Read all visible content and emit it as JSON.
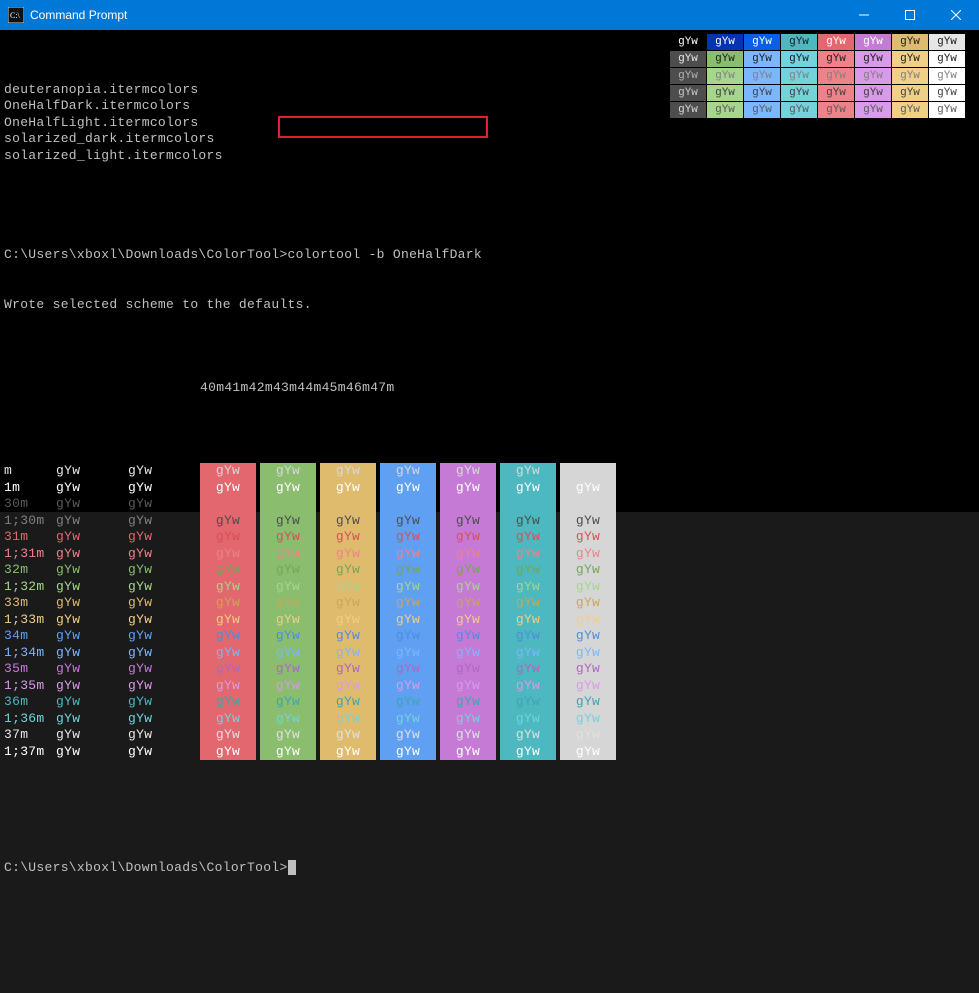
{
  "window": {
    "title": "Command Prompt"
  },
  "listing": [
    "deuteranopia.itermcolors",
    "OneHalfDark.itermcolors",
    "OneHalfLight.itermcolors",
    "solarized_dark.itermcolors",
    "solarized_light.itermcolors"
  ],
  "prompt_path": "C:\\Users\\xboxl\\Downloads\\ColorTool>",
  "command": "colortool -b OneHalfDark",
  "output_msg": "Wrote selected scheme to the defaults.",
  "bg_headers": [
    "40m",
    "41m",
    "42m",
    "43m",
    "44m",
    "45m",
    "46m",
    "47m"
  ],
  "samp": "gYw",
  "row_labels": [
    "m",
    "1m",
    "30m",
    "1;30m",
    "31m",
    "1;31m",
    "32m",
    "1;32m",
    "33m",
    "1;33m",
    "34m",
    "1;34m",
    "35m",
    "1;35m",
    "36m",
    "1;36m",
    "37m",
    "1;37m"
  ],
  "fg_classes_a": [
    "fg-white",
    "fg-bwhite",
    "fg-dgray",
    "fg-gray",
    "fg-red",
    "fg-bred",
    "fg-green",
    "fg-bgreen",
    "fg-yellow",
    "fg-byellow",
    "fg-blue",
    "fg-bblue",
    "fg-mag",
    "fg-bmag",
    "fg-cyan",
    "fg-bcyan",
    "fg-white",
    "fg-bwhite"
  ],
  "on_bg_fg": {
    "m": "#d8d8d8",
    "1m": "#fff",
    "30m": "#1c1c1c",
    "1;30m": "#4d4d4d",
    "31m": "#d65055",
    "1;31m": "#ef8289",
    "32m": "#74a657",
    "1;32m": "#a5d68c",
    "33m": "#caa657",
    "1;33m": "#f0cf87",
    "34m": "#4c8de0",
    "1;34m": "#7cb6ff",
    "35m": "#b066c2",
    "1;35m": "#d99ae9",
    "36m": "#3ba6ad",
    "1;36m": "#72d3da",
    "37m": "#e0e0e0",
    "1;37m": "#fff"
  },
  "palette": [
    [
      "#000",
      "#fff"
    ],
    [
      "#0034b3",
      "#fff"
    ],
    [
      "#0a5fe6",
      "#fff"
    ],
    [
      "#4db8bf",
      "#1c1c1c"
    ],
    [
      "#e2676e",
      "#fff"
    ],
    [
      "#c57bd6",
      "#fff"
    ],
    [
      "#dfbb6e",
      "#1c1c1c"
    ],
    [
      "#e6e6e6",
      "#1c1c1c"
    ],
    [
      "#4d4d4d",
      "#e6e6e6"
    ],
    [
      "#8abd6e",
      "#1c1c1c"
    ],
    [
      "#7cb6ff",
      "#1c1c1c"
    ],
    [
      "#72d3da",
      "#1c1c1c"
    ],
    [
      "#ef8289",
      "#1c1c1c"
    ],
    [
      "#d99ae9",
      "#1c1c1c"
    ],
    [
      "#f0cf87",
      "#1c1c1c"
    ],
    [
      "#fff",
      "#1c1c1c"
    ],
    [
      "#4d4d4d",
      "#b0b0b0"
    ],
    [
      "#a5d68c",
      "#808080"
    ],
    [
      "#7cb6ff",
      "#808080"
    ],
    [
      "#72d3da",
      "#808080"
    ],
    [
      "#ef8289",
      "#808080"
    ],
    [
      "#d99ae9",
      "#808080"
    ],
    [
      "#f0cf87",
      "#808080"
    ],
    [
      "#fff",
      "#808080"
    ],
    [
      "#4d4d4d",
      "#c8c8c8"
    ],
    [
      "#a5d68c",
      "#404040"
    ],
    [
      "#7cb6ff",
      "#404040"
    ],
    [
      "#72d3da",
      "#404040"
    ],
    [
      "#ef8289",
      "#404040"
    ],
    [
      "#d99ae9",
      "#404040"
    ],
    [
      "#f0cf87",
      "#404040"
    ],
    [
      "#fff",
      "#404040"
    ],
    [
      "#4d4d4d",
      "#d6d6d6"
    ],
    [
      "#a5d68c",
      "#5a5a5a"
    ],
    [
      "#7cb6ff",
      "#5a5a5a"
    ],
    [
      "#72d3da",
      "#5a5a5a"
    ],
    [
      "#ef8289",
      "#5a5a5a"
    ],
    [
      "#d99ae9",
      "#5a5a5a"
    ],
    [
      "#f0cf87",
      "#5a5a5a"
    ],
    [
      "#fff",
      "#5a5a5a"
    ]
  ]
}
